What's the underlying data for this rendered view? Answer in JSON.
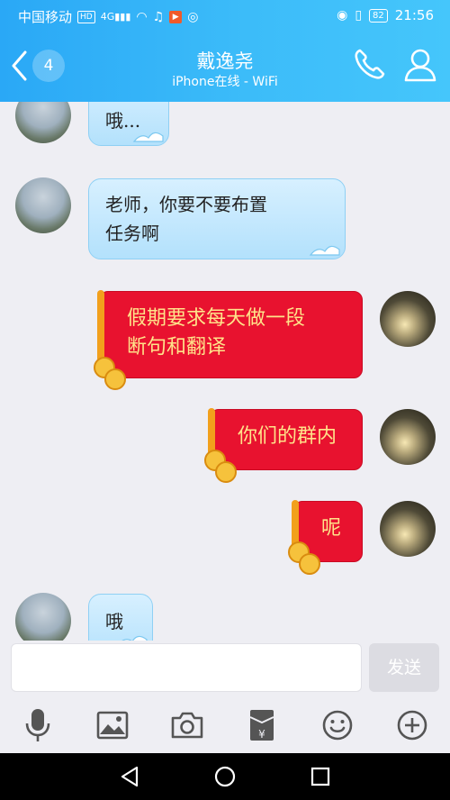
{
  "status_bar": {
    "carrier": "中国移动",
    "hd": "HD",
    "network": "4G",
    "battery": "82",
    "time": "21:56"
  },
  "header": {
    "back_count": "4",
    "title": "戴逸尧",
    "subtitle": "iPhone在线 - WiFi"
  },
  "messages": [
    {
      "side": "in",
      "text": "哦..."
    },
    {
      "side": "in",
      "line1": "老师，你要不要布置",
      "line2": "任务啊"
    },
    {
      "side": "out",
      "line1": "假期要求每天做一段",
      "line2": "断句和翻译"
    },
    {
      "side": "out",
      "text": "你们的群内"
    },
    {
      "side": "out",
      "text": "呢"
    },
    {
      "side": "in",
      "text": "哦"
    }
  ],
  "input": {
    "value": "",
    "send_label": "发送"
  },
  "toolbar": [
    "mic-icon",
    "image-icon",
    "camera-icon",
    "red-packet-icon",
    "emoji-icon",
    "plus-icon"
  ],
  "colors": {
    "header_from": "#2aa8f6",
    "header_to": "#45c6fb",
    "bubble_in": "#c6e9fd",
    "bubble_out": "#e8122f",
    "bubble_out_text": "#ffe38a"
  }
}
